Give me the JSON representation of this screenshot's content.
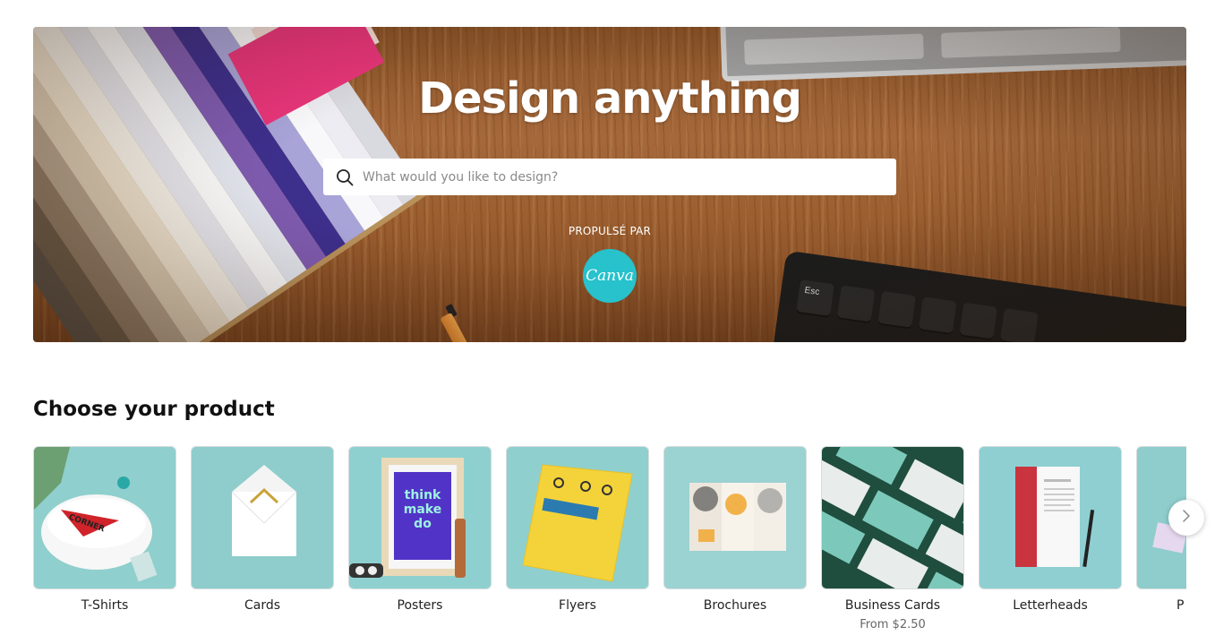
{
  "hero": {
    "title": "Design anything",
    "search_placeholder": "What would you like to design?",
    "powered_by": "PROPULSÉ PAR",
    "logo_text": "Canva"
  },
  "products_section": {
    "title": "Choose your product",
    "items": [
      {
        "name": "T-Shirts",
        "price": ""
      },
      {
        "name": "Cards",
        "price": ""
      },
      {
        "name": "Posters",
        "price": ""
      },
      {
        "name": "Flyers",
        "price": ""
      },
      {
        "name": "Brochures",
        "price": ""
      },
      {
        "name": "Business Cards",
        "price": "From $2.50"
      },
      {
        "name": "Letterheads",
        "price": ""
      },
      {
        "name": "P",
        "price": ""
      }
    ],
    "poster_text": [
      "think",
      "make",
      "do"
    ],
    "next_icon": "chevron-right-icon"
  },
  "colors": {
    "teal": "#27c2cc",
    "thumb_bg": "#8ecbcb",
    "wood": "#9c5f30"
  }
}
